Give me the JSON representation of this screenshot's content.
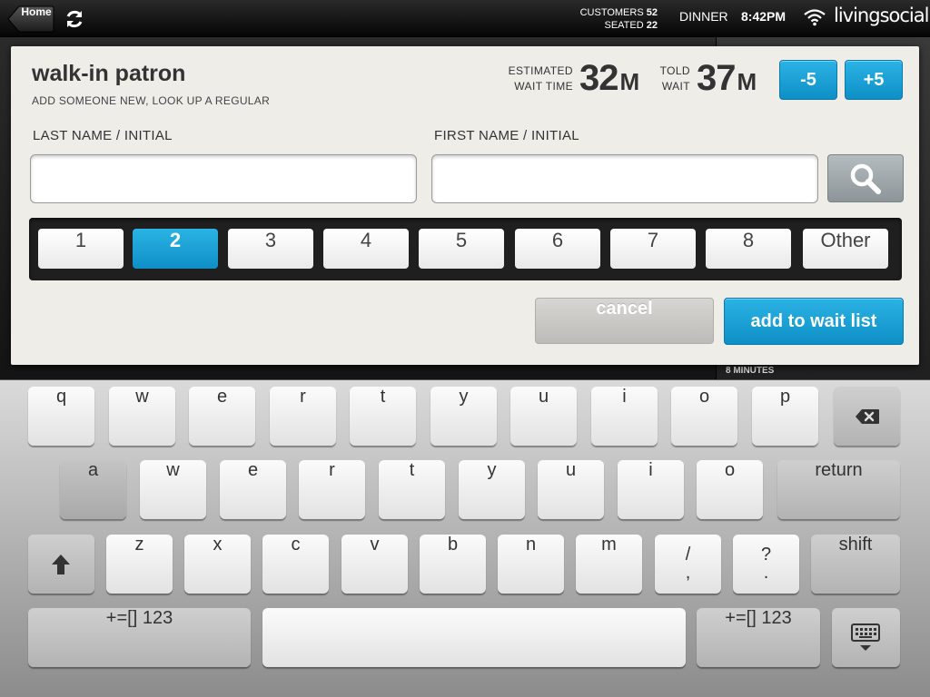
{
  "status_bar": {
    "home_label": "Home",
    "customers_label": "CUSTOMERS",
    "customers_count": "52",
    "seated_label": "SEATED",
    "seated_count": "22",
    "service": "DINNER",
    "time": "8:42PM",
    "brand": "livingsocial"
  },
  "background": {
    "minutes_label": "8 MINUTES"
  },
  "dialog": {
    "title": "walk-in patron",
    "subtitle": "ADD SOMEONE NEW, LOOK UP A REGULAR",
    "estimated_label_1": "ESTIMATED",
    "estimated_label_2": "WAIT TIME",
    "estimated_value": "32",
    "estimated_unit": "M",
    "told_label_1": "TOLD",
    "told_label_2": "WAIT",
    "told_value": "37",
    "told_unit": "M",
    "minus_label": "-5",
    "plus_label": "+5",
    "last_name_label": "LAST NAME / INITIAL",
    "last_name_value": "",
    "first_name_label": "FIRST NAME / INITIAL",
    "first_name_value": "",
    "party_sizes": [
      "1",
      "2",
      "3",
      "4",
      "5",
      "6",
      "7",
      "8",
      "Other"
    ],
    "selected_party_size": "2",
    "cancel_label": "cancel",
    "add_label": "add to wait list"
  },
  "keyboard": {
    "row1": [
      "q",
      "w",
      "e",
      "r",
      "t",
      "y",
      "u",
      "i",
      "o",
      "p"
    ],
    "row2": [
      "a",
      "w",
      "e",
      "r",
      "t",
      "y",
      "u",
      "i",
      "o"
    ],
    "return_label": "return",
    "row3": [
      "z",
      "x",
      "c",
      "v",
      "b",
      "n",
      "m"
    ],
    "slash_top": "/",
    "slash_bottom": ",",
    "question_top": "?",
    "question_bottom": ".",
    "shift_label": "shift",
    "numbers_label": "+=[] 123",
    "space_label": ""
  },
  "colors": {
    "accent": "#1aa3d8",
    "dialog_bg": "#efede8",
    "top_bar": "#111111"
  }
}
